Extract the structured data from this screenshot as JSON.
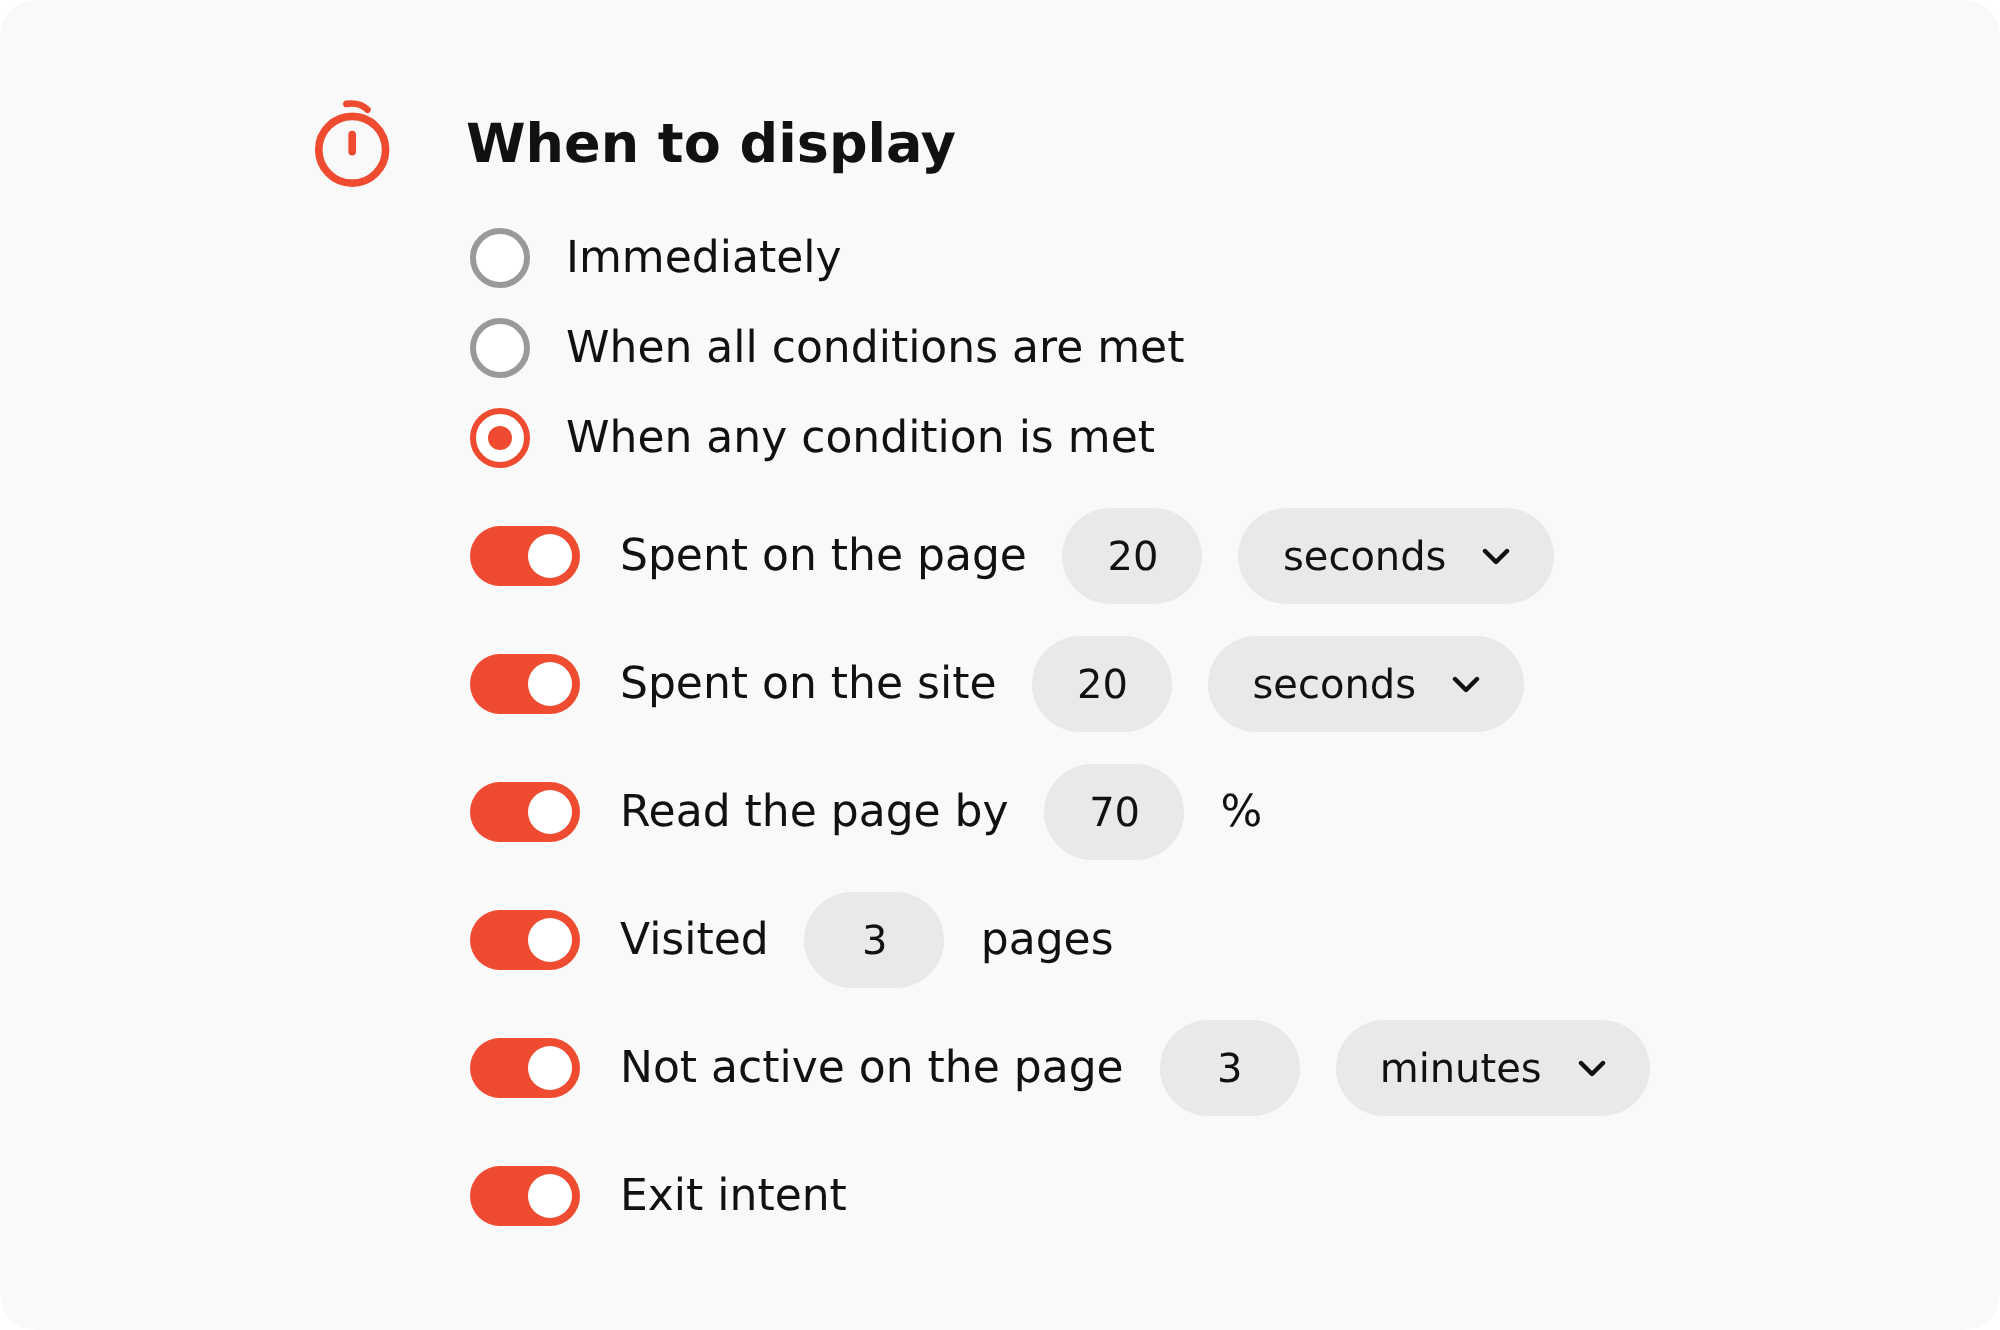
{
  "title": "When to display",
  "options": [
    {
      "label": "Immediately",
      "selected": false
    },
    {
      "label": "When all conditions are met",
      "selected": false
    },
    {
      "label": "When any condition is met",
      "selected": true
    }
  ],
  "conditions": [
    {
      "on": true,
      "parts": [
        {
          "kind": "text",
          "text": "Spent on the page"
        },
        {
          "kind": "number",
          "value": "20"
        },
        {
          "kind": "select",
          "value": "seconds"
        }
      ]
    },
    {
      "on": true,
      "parts": [
        {
          "kind": "text",
          "text": "Spent on the site"
        },
        {
          "kind": "number",
          "value": "20"
        },
        {
          "kind": "select",
          "value": "seconds"
        }
      ]
    },
    {
      "on": true,
      "parts": [
        {
          "kind": "text",
          "text": "Read the page by"
        },
        {
          "kind": "number",
          "value": "70"
        },
        {
          "kind": "text",
          "text": "%"
        }
      ]
    },
    {
      "on": true,
      "parts": [
        {
          "kind": "text",
          "text": "Visited"
        },
        {
          "kind": "number",
          "value": "3"
        },
        {
          "kind": "text",
          "text": "pages"
        }
      ]
    },
    {
      "on": true,
      "parts": [
        {
          "kind": "text",
          "text": "Not active on the page"
        },
        {
          "kind": "number",
          "value": "3"
        },
        {
          "kind": "select",
          "value": "minutes"
        }
      ]
    },
    {
      "on": true,
      "parts": [
        {
          "kind": "text",
          "text": "Exit intent"
        }
      ]
    }
  ]
}
